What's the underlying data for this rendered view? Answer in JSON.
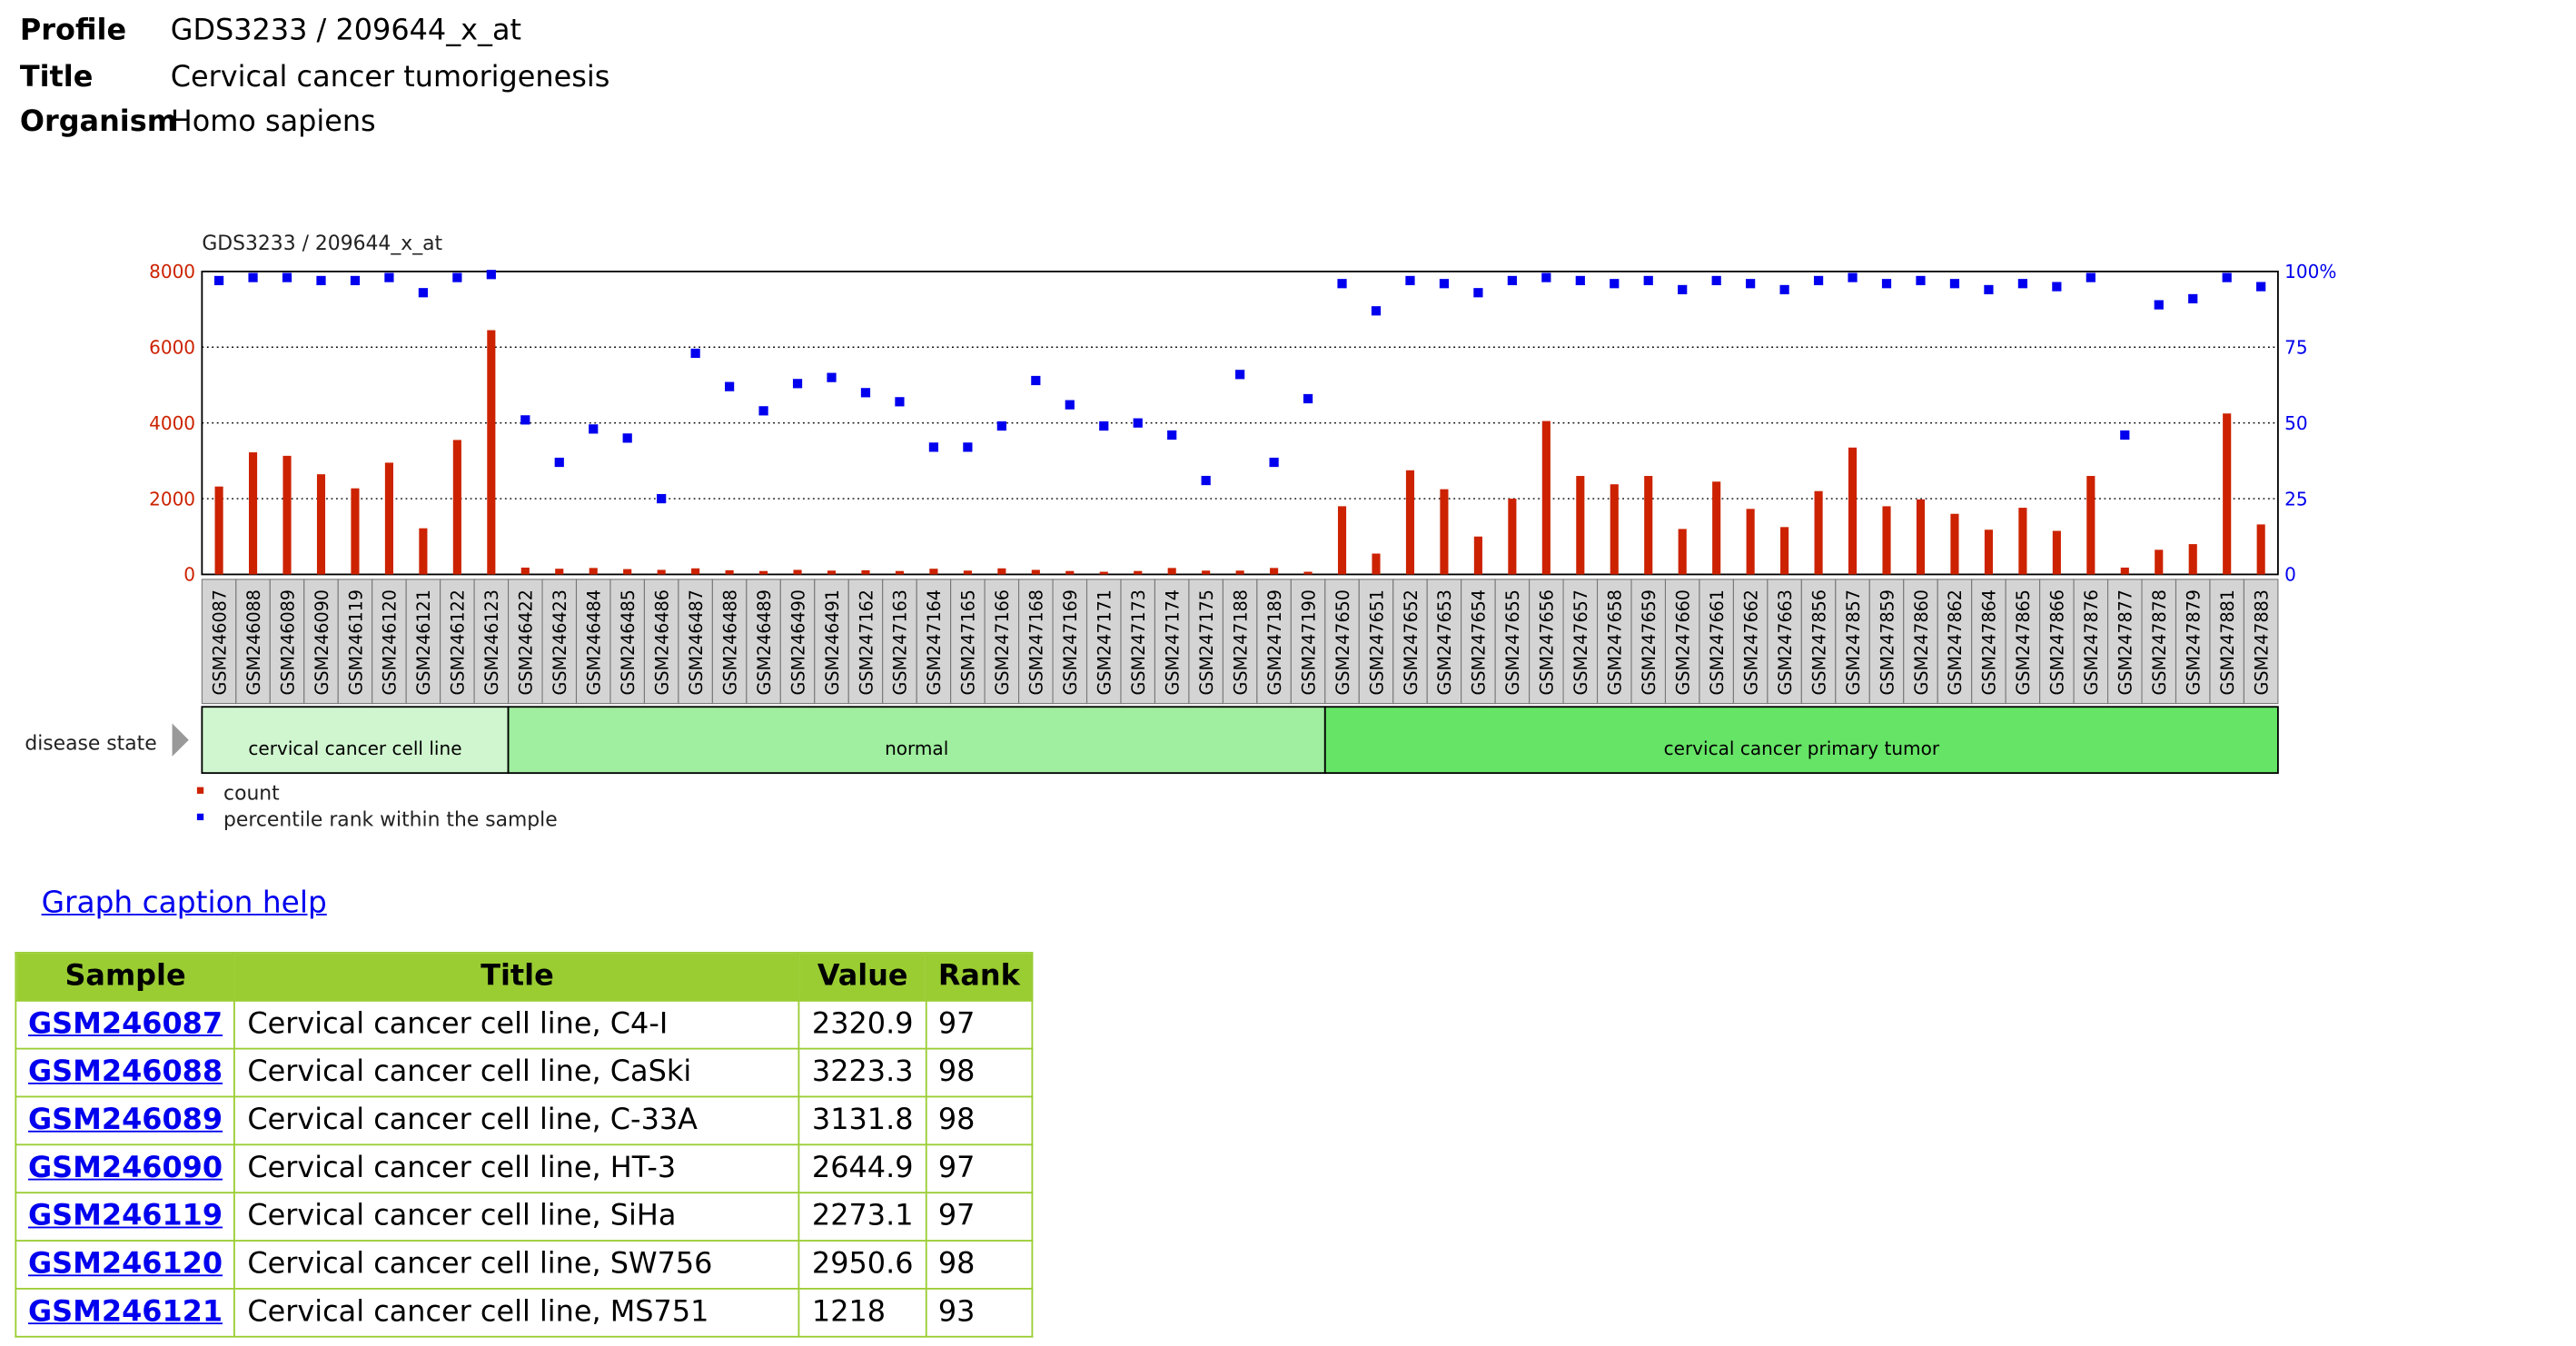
{
  "profile": {
    "profile_label": "Profile",
    "profile_value": "GDS3233 / 209644_x_at",
    "title_label": "Title",
    "title_value": "Cervical cancer tumorigenesis",
    "organism_label": "Organism",
    "organism_value": "Homo sapiens"
  },
  "caption_help": "Graph caption help",
  "chart_data": {
    "type": "bar",
    "title": "GDS3233 / 209644_x_at",
    "categories": [
      "GSM246087",
      "GSM246088",
      "GSM246089",
      "GSM246090",
      "GSM246119",
      "GSM246120",
      "GSM246121",
      "GSM246122",
      "GSM246123",
      "GSM246422",
      "GSM246423",
      "GSM246484",
      "GSM246485",
      "GSM246486",
      "GSM246487",
      "GSM246488",
      "GSM246489",
      "GSM246490",
      "GSM246491",
      "GSM247162",
      "GSM247163",
      "GSM247164",
      "GSM247165",
      "GSM247166",
      "GSM247168",
      "GSM247169",
      "GSM247171",
      "GSM247173",
      "GSM247174",
      "GSM247175",
      "GSM247188",
      "GSM247189",
      "GSM247190",
      "GSM247650",
      "GSM247651",
      "GSM247652",
      "GSM247653",
      "GSM247654",
      "GSM247655",
      "GSM247656",
      "GSM247657",
      "GSM247658",
      "GSM247659",
      "GSM247660",
      "GSM247661",
      "GSM247662",
      "GSM247663",
      "GSM247856",
      "GSM247857",
      "GSM247859",
      "GSM247860",
      "GSM247862",
      "GSM247864",
      "GSM247865",
      "GSM247866",
      "GSM247876",
      "GSM247877",
      "GSM247878",
      "GSM247879",
      "GSM247881",
      "GSM247883"
    ],
    "series": [
      {
        "name": "count",
        "color": "#cc2200",
        "axis": "left",
        "values": [
          2320.9,
          3223.3,
          3131.8,
          2644.9,
          2273.1,
          2950.6,
          1218,
          3550,
          6450,
          180,
          150,
          170,
          140,
          120,
          160,
          110,
          90,
          120,
          100,
          110,
          90,
          150,
          100,
          160,
          120,
          90,
          70,
          90,
          170,
          100,
          100,
          170,
          70,
          1800,
          550,
          2750,
          2250,
          1000,
          2000,
          4050,
          2600,
          2380,
          2600,
          1200,
          2450,
          1730,
          1250,
          2200,
          3350,
          1800,
          1980,
          1600,
          1180,
          1760,
          1150,
          2600,
          180,
          650,
          800,
          4250,
          1320
        ]
      },
      {
        "name": "percentile rank within the sample",
        "color": "#0000ee",
        "axis": "right",
        "values": [
          97,
          98,
          98,
          97,
          97,
          98,
          93,
          98,
          99,
          51,
          37,
          48,
          45,
          25,
          73,
          62,
          54,
          63,
          65,
          60,
          57,
          42,
          42,
          49,
          64,
          56,
          49,
          50,
          46,
          31,
          66,
          37,
          58,
          96,
          87,
          97,
          96,
          93,
          97,
          98,
          97,
          96,
          97,
          94,
          97,
          96,
          94,
          97,
          98,
          96,
          97,
          96,
          94,
          96,
          95,
          98,
          46,
          89,
          91,
          98,
          95
        ]
      }
    ],
    "ylim_left": [
      0,
      8000
    ],
    "ylim_right": [
      0,
      100
    ],
    "left_ticks": [
      "0",
      "2000",
      "4000",
      "6000",
      "8000"
    ],
    "right_ticks": [
      "0",
      "25",
      "50",
      "75",
      "100%"
    ],
    "grid": true,
    "legend": {
      "placement": "bottom-left",
      "items": [
        "count",
        "percentile rank within the sample"
      ]
    },
    "groups_label": "disease state",
    "groups": [
      {
        "label": "cervical cancer cell line",
        "start": 0,
        "end": 8,
        "color": "#d0f6d0"
      },
      {
        "label": "normal",
        "start": 9,
        "end": 32,
        "color": "#a0eea0"
      },
      {
        "label": "cervical cancer primary tumor",
        "start": 33,
        "end": 60,
        "color": "#66e466"
      }
    ]
  },
  "table": {
    "headers": [
      "Sample",
      "Title",
      "Value",
      "Rank"
    ],
    "rows": [
      [
        "GSM246087",
        "Cervical cancer cell line, C4-I",
        "2320.9",
        "97"
      ],
      [
        "GSM246088",
        "Cervical cancer cell line, CaSki",
        "3223.3",
        "98"
      ],
      [
        "GSM246089",
        "Cervical cancer cell line, C-33A",
        "3131.8",
        "98"
      ],
      [
        "GSM246090",
        "Cervical cancer cell line, HT-3",
        "2644.9",
        "97"
      ],
      [
        "GSM246119",
        "Cervical cancer cell line, SiHa",
        "2273.1",
        "97"
      ],
      [
        "GSM246120",
        "Cervical cancer cell line, SW756",
        "2950.6",
        "98"
      ],
      [
        "GSM246121",
        "Cervical cancer cell line, MS751",
        "1218",
        "93"
      ]
    ]
  }
}
